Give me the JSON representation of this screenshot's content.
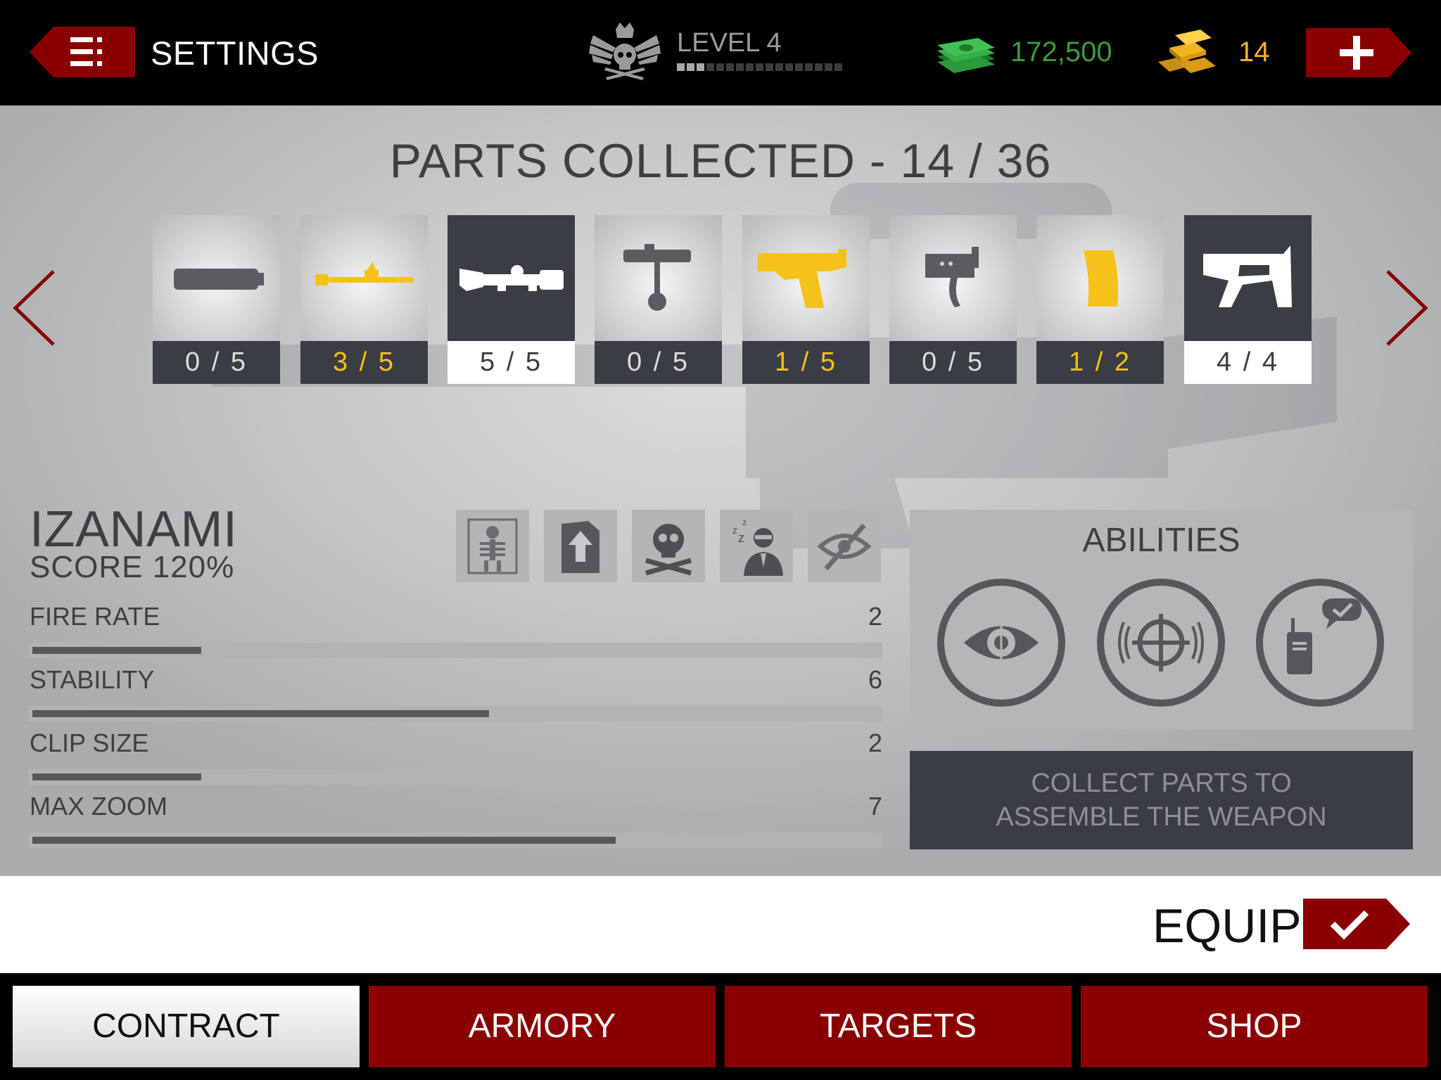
{
  "header": {
    "settings_label": "SETTINGS",
    "level_label": "LEVEL 4",
    "level_progress_segments_filled": 3,
    "level_progress_segments_total": 17,
    "cash": "172,500",
    "gold": "14",
    "icons": {
      "menu": "menu-icon",
      "rank": "skull-crown-emblem-icon",
      "cash": "cash-stack-icon",
      "gold": "gold-bars-icon",
      "buy": "plus-icon"
    }
  },
  "parts": {
    "title": "PARTS COLLECTED - 14 / 36",
    "items": [
      {
        "name": "suppressor",
        "count": "0 / 5",
        "state": "empty"
      },
      {
        "name": "barrel",
        "count": "3 / 5",
        "state": "partial"
      },
      {
        "name": "scope",
        "count": "5 / 5",
        "state": "done"
      },
      {
        "name": "bolt",
        "count": "0 / 5",
        "state": "empty"
      },
      {
        "name": "receiver",
        "count": "1 / 5",
        "state": "partial"
      },
      {
        "name": "trigger",
        "count": "0 / 5",
        "state": "empty"
      },
      {
        "name": "magazine",
        "count": "1 / 2",
        "state": "partial"
      },
      {
        "name": "stock",
        "count": "4 / 4",
        "state": "done"
      }
    ]
  },
  "weapon": {
    "name": "IZANAMI",
    "score": "SCORE 120%",
    "perks": [
      "x-ray-icon",
      "upgrade-icon",
      "skull-crossbones-icon",
      "sleeping-agent-icon",
      "hidden-eye-icon"
    ],
    "stats": [
      {
        "label": "FIRE RATE",
        "value": "2",
        "fraction": 0.2
      },
      {
        "label": "STABILITY",
        "value": "6",
        "fraction": 0.54
      },
      {
        "label": "CLIP SIZE",
        "value": "2",
        "fraction": 0.2
      },
      {
        "label": "MAX ZOOM",
        "value": "7",
        "fraction": 0.69
      }
    ]
  },
  "abilities": {
    "title": "ABILITIES",
    "icons": [
      "eye-scope-icon",
      "crosshair-pulse-icon",
      "radio-message-icon"
    ]
  },
  "assemble_message_line1": "COLLECT PARTS TO",
  "assemble_message_line2": "ASSEMBLE THE WEAPON",
  "equip_label": "EQUIP",
  "nav": {
    "tabs": [
      {
        "label": "CONTRACT",
        "active": true
      },
      {
        "label": "ARMORY",
        "active": false
      },
      {
        "label": "TARGETS",
        "active": false
      },
      {
        "label": "SHOP",
        "active": false
      }
    ]
  },
  "colors": {
    "brand_red": "#8a0000",
    "cash_green": "#3c9b3a",
    "gold_yellow": "#f2b320",
    "partial_yellow": "#f5c21b",
    "panel_dark": "#3b3d44"
  }
}
